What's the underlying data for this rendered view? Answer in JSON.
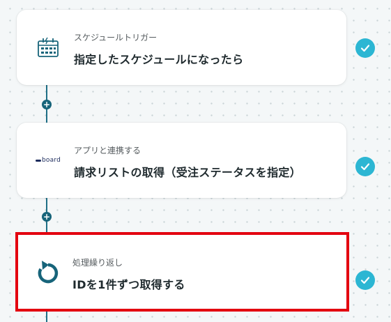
{
  "flow": {
    "steps": [
      {
        "subtitle": "スケジュールトリガー",
        "title": "指定したスケジュールになったら",
        "icon": "calendar-icon",
        "status": "completed"
      },
      {
        "subtitle": "アプリと連携する",
        "title": "請求リストの取得（受注ステータスを指定）",
        "icon": "board-logo",
        "logo_text": "board",
        "status": "completed"
      },
      {
        "subtitle": "処理繰り返し",
        "title": "IDを1件ずつ取得する",
        "icon": "loop-icon",
        "status": "completed",
        "highlighted": true
      }
    ],
    "add_symbol": "+"
  },
  "colors": {
    "accent": "#17647a",
    "check": "#2cb6d3",
    "highlight_border": "#e3000f"
  }
}
